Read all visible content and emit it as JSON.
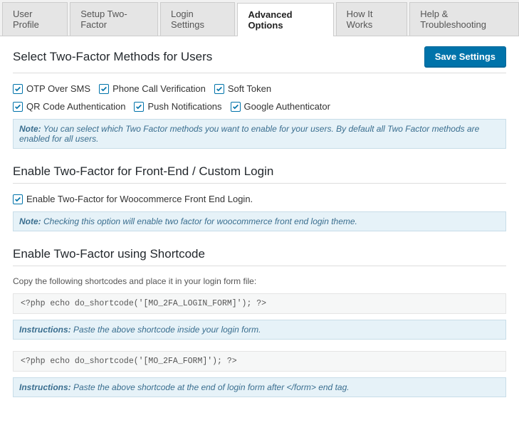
{
  "tabs": [
    {
      "label": "User Profile",
      "active": false
    },
    {
      "label": "Setup Two-Factor",
      "active": false
    },
    {
      "label": "Login Settings",
      "active": false
    },
    {
      "label": "Advanced Options",
      "active": true
    },
    {
      "label": "How It Works",
      "active": false
    },
    {
      "label": "Help & Troubleshooting",
      "active": false
    }
  ],
  "save_button_label": "Save Settings",
  "section_methods": {
    "heading": "Select Two-Factor Methods for Users",
    "row1": [
      {
        "label": "OTP Over SMS",
        "checked": true
      },
      {
        "label": "Phone Call Verification",
        "checked": true
      },
      {
        "label": "Soft Token",
        "checked": true
      }
    ],
    "row2": [
      {
        "label": "QR Code Authentication",
        "checked": true
      },
      {
        "label": "Push Notifications",
        "checked": true
      },
      {
        "label": "Google Authenticator",
        "checked": true
      }
    ],
    "note_label": "Note:",
    "note_text": " You can select which Two Factor methods you want to enable for your users. By default all Two Factor methods are enabled for all users."
  },
  "section_front": {
    "heading": "Enable Two-Factor for Front-End / Custom Login",
    "checkbox_label": "Enable Two-Factor for Woocommerce Front End Login.",
    "checked": true,
    "note_label": "Note:",
    "note_text": " Checking this option will enable two factor for woocommerce front end login theme."
  },
  "section_short": {
    "heading": "Enable Two-Factor using Shortcode",
    "intro": "Copy the following shortcodes and place it in your login form file:",
    "code1": "<?php echo do_shortcode('[MO_2FA_LOGIN_FORM]'); ?>",
    "instr1_label": "Instructions:",
    "instr1_text": " Paste the above shortcode inside your login form.",
    "code2": "<?php echo do_shortcode('[MO_2FA_FORM]'); ?>",
    "instr2_label": "Instructions:",
    "instr2_text": " Paste the above shortcode at the end of login form after </form> end tag."
  }
}
